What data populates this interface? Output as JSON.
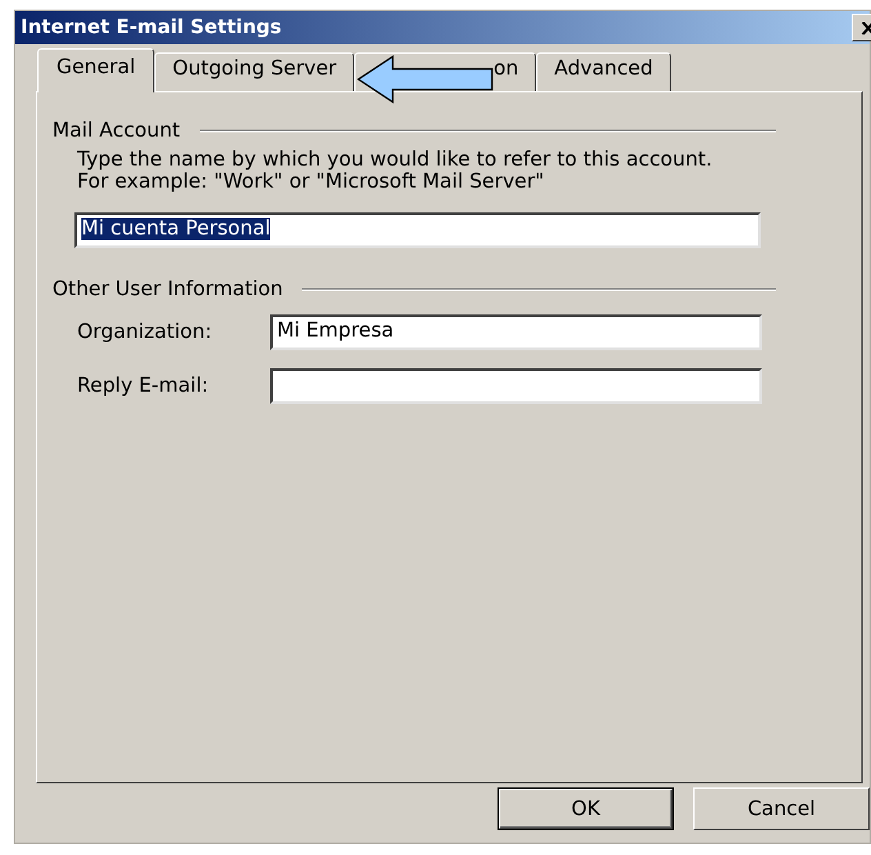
{
  "window": {
    "title": "Internet E-mail Settings"
  },
  "tabs": [
    {
      "label": "General",
      "selected": true
    },
    {
      "label": "Outgoing Server",
      "selected": false
    },
    {
      "label": "on",
      "selected": false
    },
    {
      "label": "Advanced",
      "selected": false
    }
  ],
  "mail_account": {
    "heading": "Mail Account",
    "description": "Type the name by which you would like to refer to this account.  For example: \"Work\" or \"Microsoft Mail Server\"",
    "account_name": {
      "value": "Mi cuenta Personal",
      "highlighted": true
    }
  },
  "other_user_information": {
    "heading": "Other User Information",
    "fields": [
      {
        "label": "Organization:",
        "value": "Mi Empresa"
      },
      {
        "label": "Reply E-mail:"
      }
    ]
  },
  "buttons": [
    {
      "label": "OK",
      "default": true
    },
    {
      "label": "Cancel",
      "default": false
    }
  ]
}
